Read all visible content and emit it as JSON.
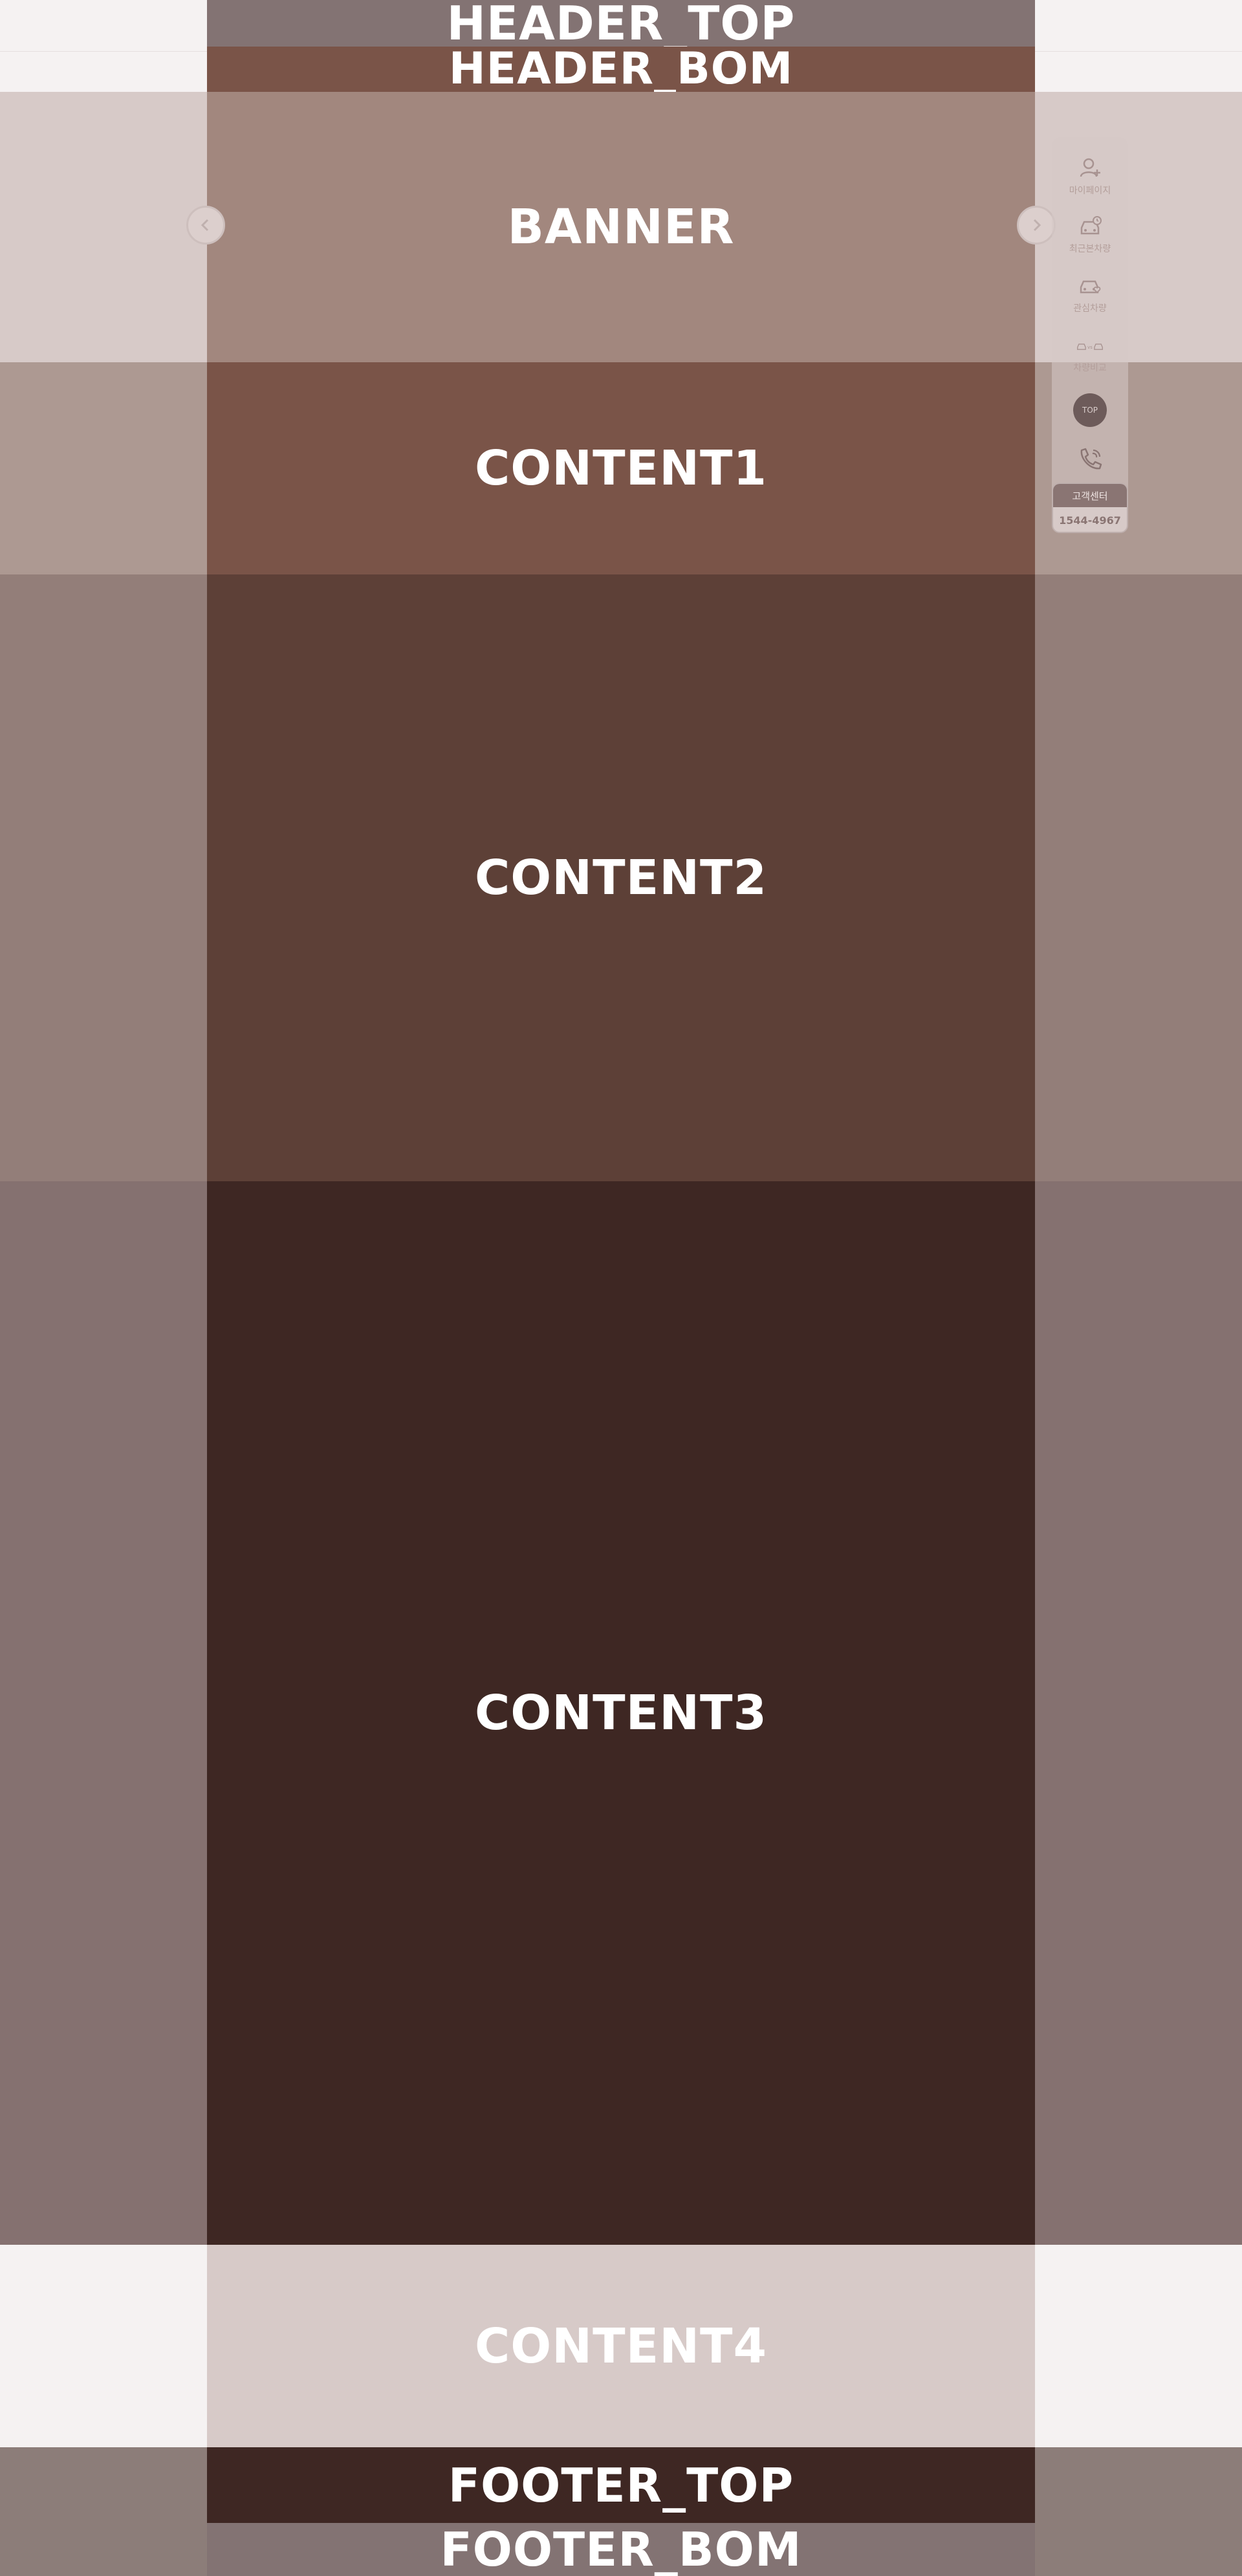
{
  "sections": {
    "header_top": "HEADER_TOP",
    "header_bom": "HEADER_BOM",
    "banner": "BANNER",
    "content1": "CONTENT1",
    "content2": "CONTENT2",
    "content3": "CONTENT3",
    "content4": "CONTENT4",
    "footer_top": "FOOTER_TOP",
    "footer_bom": "FOOTER_BOM"
  },
  "banner_nav": {
    "prev_icon": "chevron-left-icon",
    "next_icon": "chevron-right-icon"
  },
  "quick_menu": {
    "items": [
      {
        "label": "마이페이지",
        "icon": "user-plus-icon"
      },
      {
        "label": "최근본차량",
        "icon": "car-recent-icon"
      },
      {
        "label": "관심차량",
        "icon": "car-heart-icon"
      },
      {
        "label": "차량비교",
        "icon": "car-compare-icon"
      }
    ],
    "compare_vs": "vs",
    "top_label": "TOP",
    "phone_icon": "phone-icon",
    "customer_center": "고객센터",
    "phone_number": "1544-4967"
  },
  "colors": {
    "page_bg": "#f5f2f2",
    "content1": "#7a5448",
    "content2": "#5d4037",
    "content3": "#3e2723",
    "content4": "#d7cac8",
    "banner": "#a2877e"
  }
}
